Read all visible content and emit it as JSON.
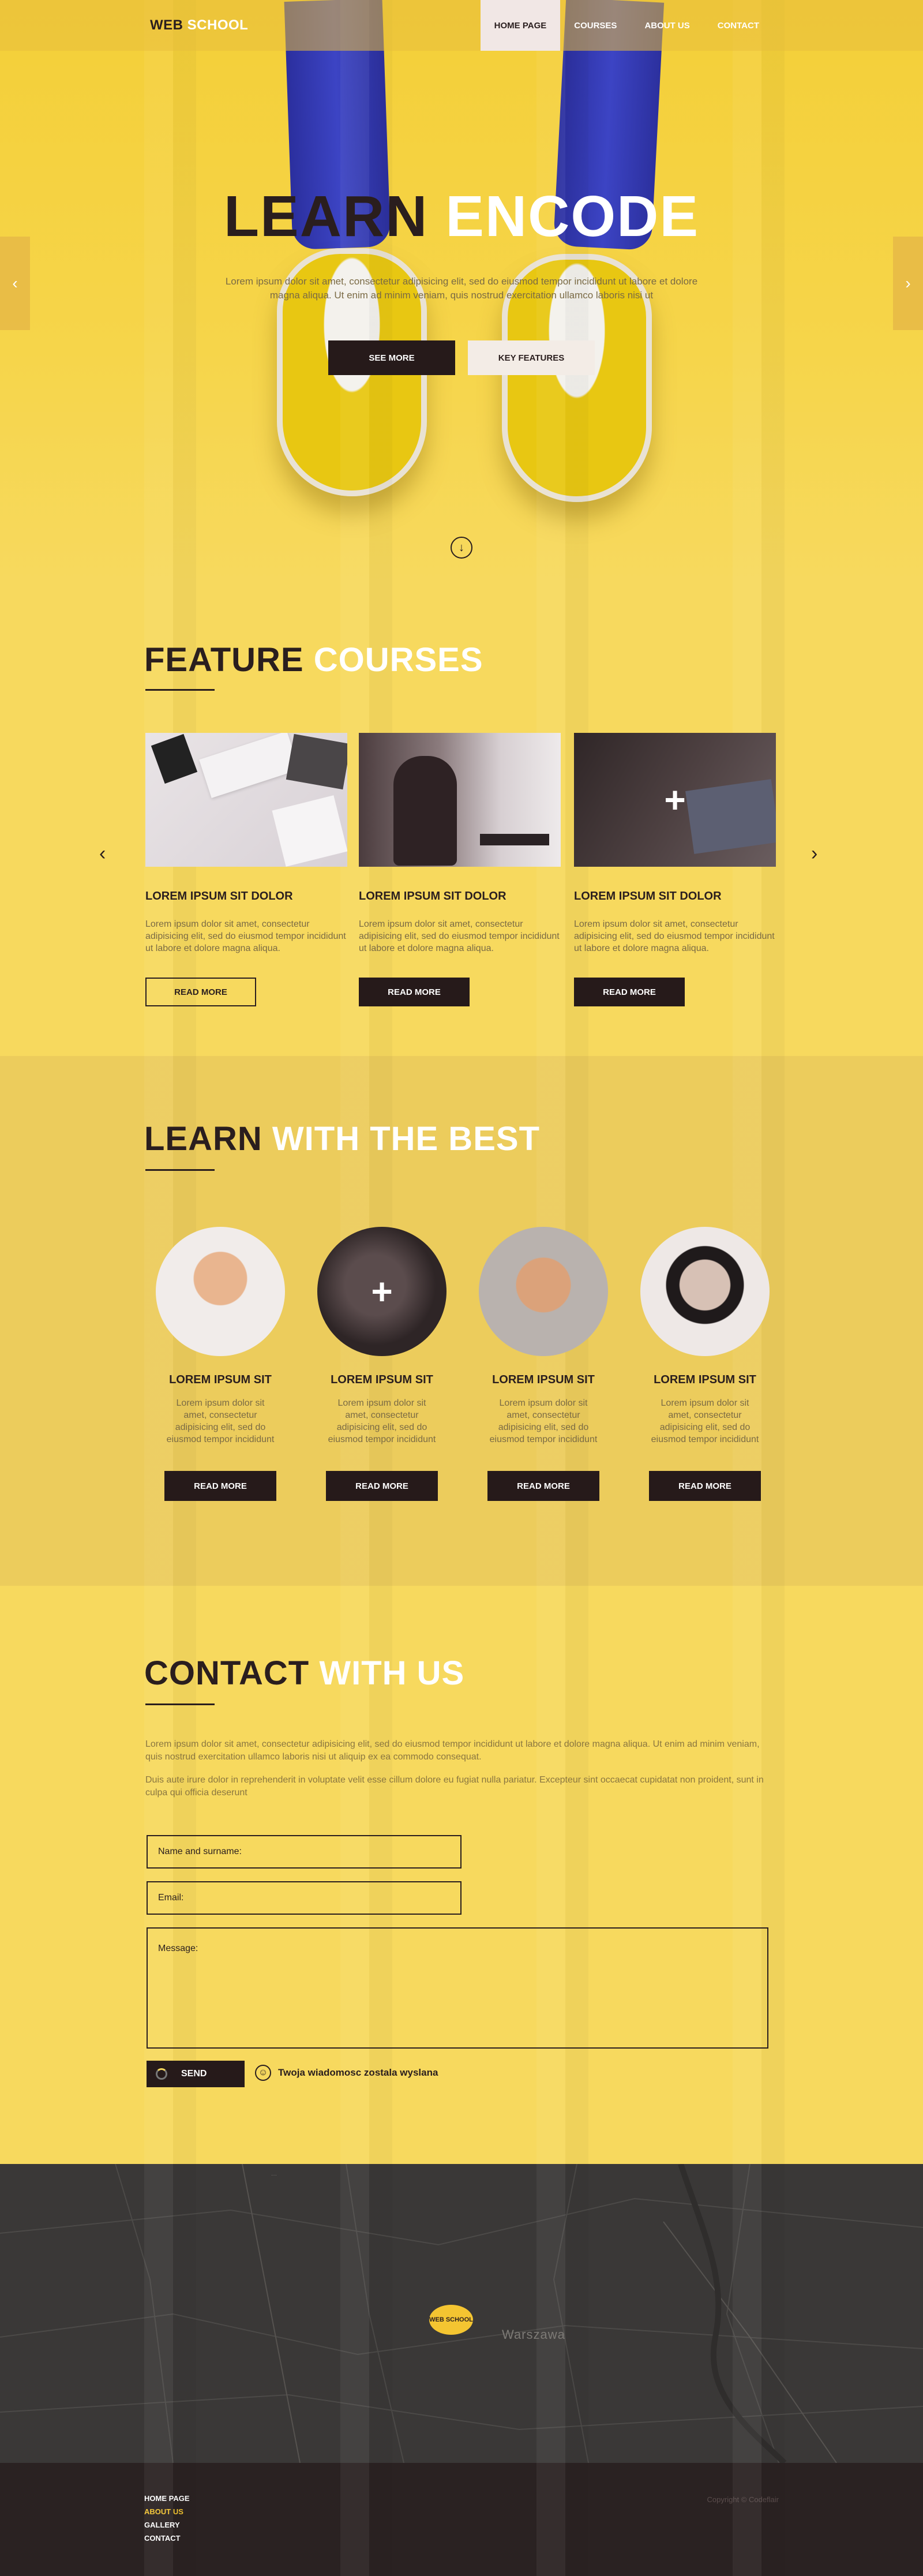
{
  "header": {
    "logo_a": "WEB",
    "logo_b": "SCHOOL",
    "nav": [
      "HOME PAGE",
      "COURSES",
      "ABOUT US",
      "CONTACT"
    ]
  },
  "hero": {
    "title_a": "LEARN",
    "title_b": "ENCODE",
    "text": "Lorem ipsum dolor sit amet, consectetur adipisicing elit, sed do eiusmod tempor incididunt ut labore et dolore magna aliqua. Ut enim ad minim veniam, quis nostrud exercitation ullamco laboris nisi ut",
    "btn_primary": "SEE MORE",
    "btn_secondary": "KEY FEATURES",
    "prev_arrow": "‹",
    "next_arrow": "›",
    "scroll_icon": "↓"
  },
  "courses": {
    "title_a": "FEATURE",
    "title_b": "COURSES",
    "prev": "‹",
    "next": "›",
    "items": [
      {
        "title": "LOREM IPSUM SIT DOLOR",
        "desc": "Lorem ipsum dolor sit amet, consectetur adipisicing elit, sed do eiusmod tempor incididunt ut labore et dolore magna aliqua.",
        "btn": "READ MORE"
      },
      {
        "title": "LOREM IPSUM SIT DOLOR",
        "desc": "Lorem ipsum dolor sit amet, consectetur adipisicing elit, sed do eiusmod tempor incididunt ut labore et dolore magna aliqua.",
        "btn": "READ MORE"
      },
      {
        "title": "LOREM IPSUM SIT DOLOR",
        "desc": "Lorem ipsum dolor sit amet, consectetur adipisicing elit, sed do eiusmod tempor incididunt ut labore et dolore magna aliqua.",
        "btn": "READ MORE"
      }
    ]
  },
  "team": {
    "title_a": "LEARN",
    "title_b": "WITH THE BEST",
    "plus": "+",
    "members": [
      {
        "name": "LOREM IPSUM SIT",
        "desc": "Lorem ipsum dolor sit amet, consectetur adipisicing elit, sed do eiusmod tempor incididunt",
        "btn": "READ MORE"
      },
      {
        "name": "LOREM IPSUM SIT",
        "desc": "Lorem ipsum dolor sit amet, consectetur adipisicing elit, sed do eiusmod tempor incididunt",
        "btn": "READ MORE"
      },
      {
        "name": "LOREM IPSUM SIT",
        "desc": "Lorem ipsum dolor sit amet, consectetur adipisicing elit, sed do eiusmod tempor incididunt",
        "btn": "READ MORE"
      },
      {
        "name": "LOREM IPSUM SIT",
        "desc": "Lorem ipsum dolor sit amet, consectetur adipisicing elit, sed do eiusmod tempor incididunt",
        "btn": "READ MORE"
      }
    ]
  },
  "contact": {
    "title_a": "CONTACT",
    "title_b": "WITH US",
    "p1": "Lorem ipsum dolor sit amet, consectetur adipisicing elit, sed do eiusmod tempor incididunt ut labore et dolore magna aliqua. Ut enim ad minim veniam, quis nostrud exercitation ullamco laboris nisi ut aliquip ex ea commodo consequat.",
    "p2": "Duis aute irure dolor in reprehenderit in voluptate velit esse cillum dolore eu fugiat nulla pariatur. Excepteur sint occaecat cupidatat non proident, sunt in culpa qui officia deserunt",
    "name_placeholder": "Name and surname:",
    "email_placeholder": "Email:",
    "message_placeholder": "Message:",
    "send": "SEND",
    "status": "Twoja wiadomosc zostala wyslana"
  },
  "map": {
    "city": "Warszawa",
    "pin_a": "WEB",
    "pin_b": "SCHOOL"
  },
  "footer": {
    "links": [
      "HOME PAGE",
      "ABOUT US",
      "GALLERY",
      "CONTACT"
    ],
    "copyright": "Copyright © Codeflair"
  },
  "colors": {
    "accent": "#f7d95e",
    "dark": "#261a1a",
    "map": "#3a3837",
    "footer": "#2a2222"
  }
}
